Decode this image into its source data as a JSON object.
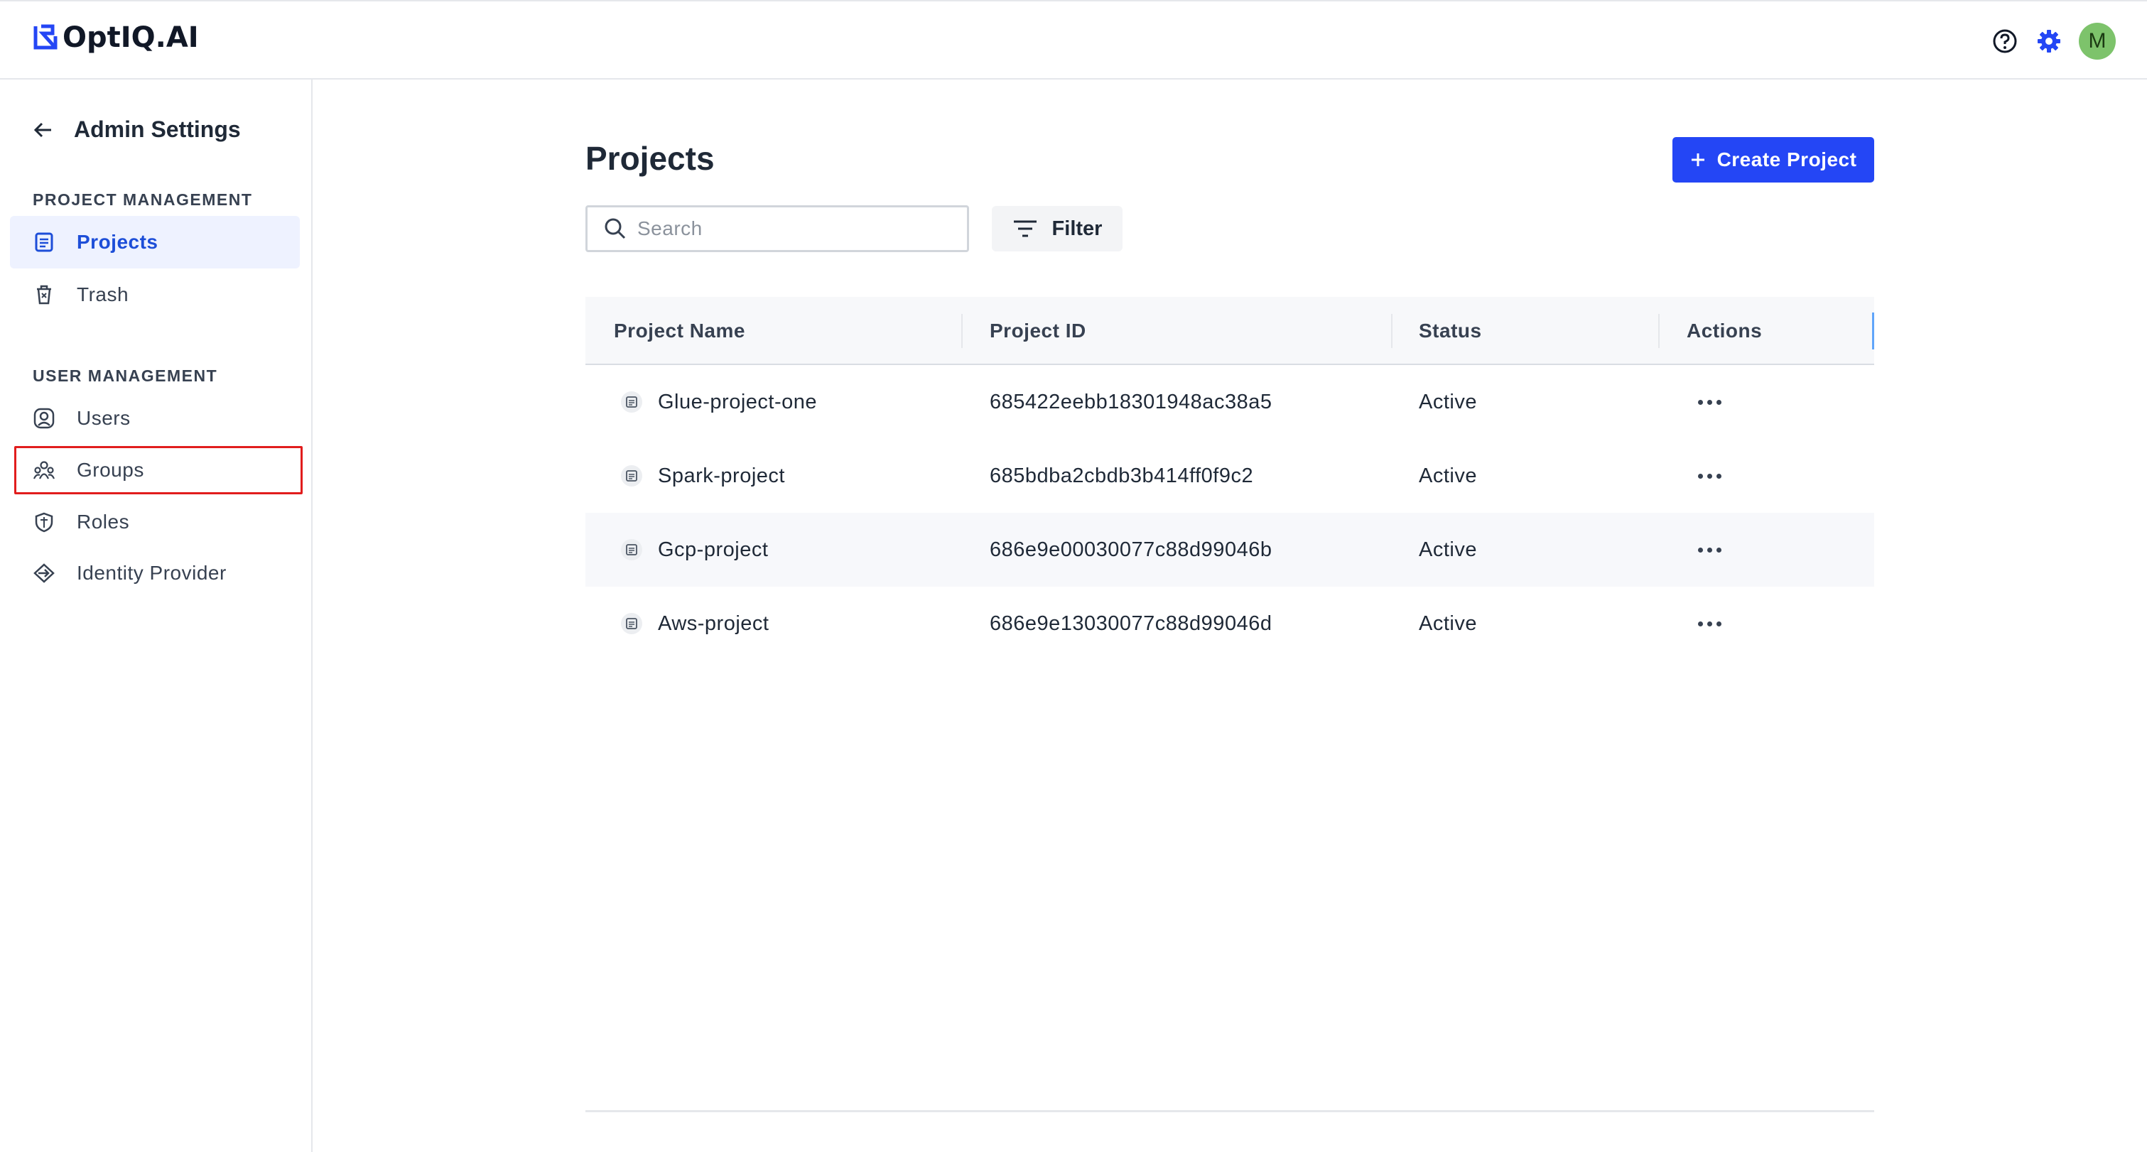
{
  "app": {
    "name": "OptIQ.AI",
    "avatar_initial": "M",
    "icons": [
      "help-icon",
      "settings-icon"
    ],
    "colors": {
      "accent": "#2446f5",
      "avatar": "#7dc36b",
      "highlight_box": "#e11d1d"
    }
  },
  "sidebar": {
    "title": "Admin Settings",
    "sections": [
      {
        "label": "PROJECT MANAGEMENT",
        "items": [
          {
            "label": "Projects",
            "icon": "document-icon",
            "active": true
          },
          {
            "label": "Trash",
            "icon": "trash-icon",
            "active": false
          }
        ]
      },
      {
        "label": "USER MANAGEMENT",
        "items": [
          {
            "label": "Users",
            "icon": "user-icon",
            "active": false
          },
          {
            "label": "Groups",
            "icon": "group-icon",
            "active": false,
            "highlighted": true
          },
          {
            "label": "Roles",
            "icon": "role-icon",
            "active": false
          },
          {
            "label": "Identity Provider",
            "icon": "identity-icon",
            "active": false
          }
        ]
      }
    ]
  },
  "main": {
    "title": "Projects",
    "create_button": "Create Project",
    "search": {
      "placeholder": "Search",
      "value": ""
    },
    "filter_button": "Filter",
    "table": {
      "columns": [
        "Project Name",
        "Project ID",
        "Status",
        "Actions"
      ],
      "rows": [
        {
          "name": "Glue-project-one",
          "id": "685422eebb18301948ac38a5",
          "status": "Active"
        },
        {
          "name": "Spark-project",
          "id": "685bdba2cbdb3b414ff0f9c2",
          "status": "Active"
        },
        {
          "name": "Gcp-project",
          "id": "686e9e00030077c88d99046b",
          "status": "Active"
        },
        {
          "name": "Aws-project",
          "id": "686e9e13030077c88d99046d",
          "status": "Active"
        }
      ]
    }
  }
}
